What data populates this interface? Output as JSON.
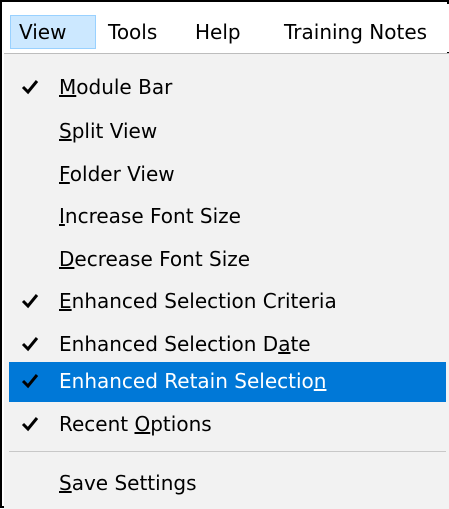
{
  "menubar": {
    "items": [
      {
        "label": "View",
        "active": true
      },
      {
        "label": "Tools"
      },
      {
        "label": "Help"
      },
      {
        "label": "Training Notes"
      }
    ]
  },
  "menu": {
    "items": [
      {
        "pre": "",
        "accel": "M",
        "post": "odule Bar",
        "checked": true
      },
      {
        "pre": "",
        "accel": "S",
        "post": "plit View",
        "checked": false
      },
      {
        "pre": "",
        "accel": "F",
        "post": "older View",
        "checked": false
      },
      {
        "pre": "",
        "accel": "I",
        "post": "ncrease Font Size",
        "checked": false
      },
      {
        "pre": "",
        "accel": "D",
        "post": "ecrease Font Size",
        "checked": false
      },
      {
        "pre": "",
        "accel": "E",
        "post": "nhanced Selection Criteria",
        "checked": true
      },
      {
        "pre": "Enhanced Selection D",
        "accel": "a",
        "post": "te",
        "checked": true
      },
      {
        "pre": "Enhanced Retain Selectio",
        "accel": "n",
        "post": "",
        "checked": true,
        "highlighted": true
      },
      {
        "pre": "Recent ",
        "accel": "O",
        "post": "ptions",
        "checked": true
      },
      {
        "pre": "",
        "accel": "S",
        "post": "ave Settings",
        "checked": false
      }
    ],
    "check_icon": "checkmark-icon",
    "highlight_color": "#0078d7",
    "menu_background": "#f2f2f2",
    "menubar_active_color": "#cce8ff"
  }
}
